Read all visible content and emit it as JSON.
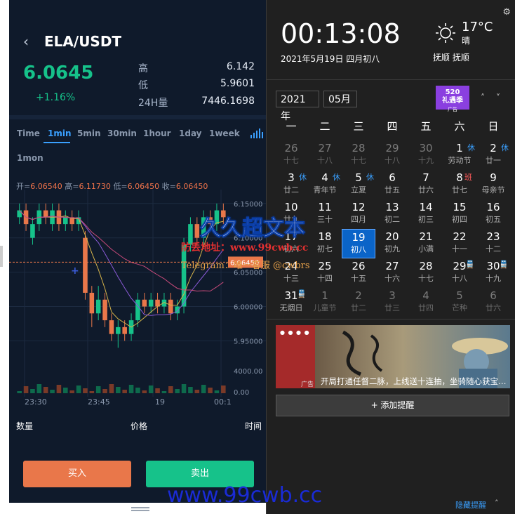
{
  "trade": {
    "back_icon": "chevron-left-icon",
    "pair": "ELA/USDT",
    "last_price": "6.0645",
    "change_pct": "+1.16%",
    "stats": [
      {
        "label": "高",
        "value": "6.142"
      },
      {
        "label": "低",
        "value": "5.9601"
      },
      {
        "label": "24H量",
        "value": "7446.1698"
      }
    ],
    "tabs": [
      "Time",
      "1min",
      "5min",
      "30min",
      "1hour",
      "1day",
      "1week",
      "1mon"
    ],
    "active_tab": "1min",
    "ohlc": {
      "open_label": "开=",
      "open": "6.06540",
      "high_label": "高=",
      "high": "6.11730",
      "low_label": "低=",
      "low": "6.06450",
      "close_label": "收=",
      "close": "6.06450"
    },
    "bottom_headers": {
      "qty": "数量",
      "price": "价格",
      "time": "时间"
    },
    "buy_label": "买入",
    "sell_label": "卖出",
    "colors": {
      "up": "#16c28a",
      "down": "#e9774a",
      "accent": "#3aa0ff"
    }
  },
  "chart_data": {
    "type": "candlestick",
    "y_ticks": [
      "6.15000",
      "6.10000",
      "6.05000",
      "6.00000",
      "5.95000"
    ],
    "volume_ticks": [
      "4000.00",
      "0.00"
    ],
    "current_price_label": "6.06450",
    "x_labels": [
      "23:30",
      "23:45",
      "19",
      "00:1"
    ],
    "candles": [
      {
        "o": 6.13,
        "c": 6.14,
        "h": 6.15,
        "l": 6.12,
        "up": true
      },
      {
        "o": 6.14,
        "c": 6.12,
        "h": 6.15,
        "l": 6.11,
        "up": false
      },
      {
        "o": 6.1,
        "c": 6.12,
        "h": 6.13,
        "l": 6.09,
        "up": true
      },
      {
        "o": 6.12,
        "c": 6.14,
        "h": 6.15,
        "l": 6.11,
        "up": true
      },
      {
        "o": 6.14,
        "c": 6.13,
        "h": 6.15,
        "l": 6.12,
        "up": false
      },
      {
        "o": 6.12,
        "c": 6.14,
        "h": 6.15,
        "l": 6.11,
        "up": true
      },
      {
        "o": 6.14,
        "c": 6.12,
        "h": 6.15,
        "l": 6.11,
        "up": false
      },
      {
        "o": 6.12,
        "c": 6.13,
        "h": 6.14,
        "l": 6.11,
        "up": true
      },
      {
        "o": 6.13,
        "c": 6.12,
        "h": 6.14,
        "l": 6.11,
        "up": false
      },
      {
        "o": 6.12,
        "c": 6.13,
        "h": 6.14,
        "l": 6.11,
        "up": true
      },
      {
        "o": 6.1,
        "c": 6.02,
        "h": 6.11,
        "l": 6.01,
        "up": false
      },
      {
        "o": 6.02,
        "c": 5.99,
        "h": 6.03,
        "l": 5.97,
        "up": false
      },
      {
        "o": 5.99,
        "c": 6.01,
        "h": 6.03,
        "l": 5.98,
        "up": true
      },
      {
        "o": 6.01,
        "c": 5.98,
        "h": 6.02,
        "l": 5.97,
        "up": false
      },
      {
        "o": 5.98,
        "c": 5.96,
        "h": 5.99,
        "l": 5.95,
        "up": false
      },
      {
        "o": 5.96,
        "c": 5.97,
        "h": 5.98,
        "l": 5.94,
        "up": true
      },
      {
        "o": 5.97,
        "c": 5.96,
        "h": 5.98,
        "l": 5.95,
        "up": false
      },
      {
        "o": 5.96,
        "c": 5.98,
        "h": 5.99,
        "l": 5.95,
        "up": true
      },
      {
        "o": 5.98,
        "c": 6.01,
        "h": 6.02,
        "l": 5.97,
        "up": true
      },
      {
        "o": 6.01,
        "c": 6.0,
        "h": 6.02,
        "l": 5.99,
        "up": false
      },
      {
        "o": 6.0,
        "c": 6.01,
        "h": 6.02,
        "l": 5.99,
        "up": true
      },
      {
        "o": 6.01,
        "c": 6.0,
        "h": 6.02,
        "l": 5.99,
        "up": false
      },
      {
        "o": 6.0,
        "c": 6.01,
        "h": 6.02,
        "l": 5.99,
        "up": true
      },
      {
        "o": 6.01,
        "c": 5.99,
        "h": 6.02,
        "l": 5.98,
        "up": false
      },
      {
        "o": 5.99,
        "c": 6.0,
        "h": 6.01,
        "l": 5.98,
        "up": true
      },
      {
        "o": 6.0,
        "c": 6.09,
        "h": 6.1,
        "l": 5.99,
        "up": true
      },
      {
        "o": 6.09,
        "c": 6.12,
        "h": 6.13,
        "l": 6.08,
        "up": true
      },
      {
        "o": 6.12,
        "c": 6.1,
        "h": 6.13,
        "l": 6.09,
        "up": false
      },
      {
        "o": 6.1,
        "c": 6.13,
        "h": 6.14,
        "l": 6.09,
        "up": true
      },
      {
        "o": 6.13,
        "c": 6.12,
        "h": 6.14,
        "l": 6.11,
        "up": false
      },
      {
        "o": 6.12,
        "c": 6.14,
        "h": 6.15,
        "l": 6.11,
        "up": true
      },
      {
        "o": 6.14,
        "c": 6.13,
        "h": 6.15,
        "l": 6.12,
        "up": false
      }
    ],
    "ylim": [
      5.93,
      6.16
    ]
  },
  "calendar_panel": {
    "settings_icon": "gear-icon",
    "time": "00:13:08",
    "date": "2021年5月19日  四月初八",
    "weather": {
      "icon": "sun-icon",
      "temp": "17°C",
      "desc": "晴",
      "location": "抚顺 抚顺"
    },
    "year_select": "2021年",
    "month_select": "05月",
    "promo": {
      "line1": "520",
      "line2": "礼遇季",
      "tag": "广告"
    },
    "nav": {
      "up": "˄",
      "down": "˅"
    },
    "weekdays": [
      "一",
      "二",
      "三",
      "四",
      "五",
      "六",
      "日"
    ],
    "days": [
      {
        "n": "26",
        "s": "十七",
        "other": true
      },
      {
        "n": "27",
        "s": "十八",
        "other": true
      },
      {
        "n": "28",
        "s": "十七",
        "other": true
      },
      {
        "n": "29",
        "s": "十八",
        "other": true
      },
      {
        "n": "30",
        "s": "十九",
        "other": true
      },
      {
        "n": "1",
        "s": "劳动节",
        "tag": "休",
        "tagtype": "rest"
      },
      {
        "n": "2",
        "s": "廿一",
        "tag": "休",
        "tagtype": "rest"
      },
      {
        "n": "3",
        "s": "廿二",
        "tag": "休",
        "tagtype": "rest"
      },
      {
        "n": "4",
        "s": "青年节",
        "tag": "休",
        "tagtype": "rest"
      },
      {
        "n": "5",
        "s": "立夏",
        "tag": "休",
        "tagtype": "rest"
      },
      {
        "n": "6",
        "s": "廿五"
      },
      {
        "n": "7",
        "s": "廿六"
      },
      {
        "n": "8",
        "s": "廿七",
        "tag": "班",
        "tagtype": "work"
      },
      {
        "n": "9",
        "s": "母亲节"
      },
      {
        "n": "10",
        "s": "廿九"
      },
      {
        "n": "11",
        "s": "三十"
      },
      {
        "n": "12",
        "s": "四月"
      },
      {
        "n": "13",
        "s": "初二"
      },
      {
        "n": "14",
        "s": "初三"
      },
      {
        "n": "15",
        "s": "初四"
      },
      {
        "n": "16",
        "s": "初五"
      },
      {
        "n": "17",
        "s": "初六"
      },
      {
        "n": "18",
        "s": "初七"
      },
      {
        "n": "19",
        "s": "初八",
        "today": true
      },
      {
        "n": "20",
        "s": "初九"
      },
      {
        "n": "21",
        "s": "小满"
      },
      {
        "n": "22",
        "s": "十一"
      },
      {
        "n": "23",
        "s": "十二"
      },
      {
        "n": "24",
        "s": "十三"
      },
      {
        "n": "25",
        "s": "十四"
      },
      {
        "n": "26",
        "s": "十五"
      },
      {
        "n": "27",
        "s": "十六"
      },
      {
        "n": "28",
        "s": "十七"
      },
      {
        "n": "29",
        "s": "十八",
        "tag": "🚆",
        "tagtype": "trn"
      },
      {
        "n": "30",
        "s": "十九",
        "tag": "🚆",
        "tagtype": "trn"
      },
      {
        "n": "31",
        "s": "无烟日",
        "tag": "🚆",
        "tagtype": "trn"
      },
      {
        "n": "1",
        "s": "儿童节",
        "other": true
      },
      {
        "n": "2",
        "s": "廿二",
        "other": true
      },
      {
        "n": "3",
        "s": "廿三",
        "other": true
      },
      {
        "n": "4",
        "s": "廿四",
        "other": true
      },
      {
        "n": "5",
        "s": "芒种",
        "other": true
      },
      {
        "n": "6",
        "s": "廿六",
        "other": true
      }
    ],
    "ad": {
      "caption": "开局打通任督二脉，上线送十连抽，坐骑随心获宝…",
      "tag": "广告"
    },
    "add_reminder": "+ 添加提醒",
    "hide_reminder": "隐藏提醒",
    "hide_arrow": "˄"
  },
  "watermarks": {
    "line1": "久久超文本",
    "line2": "防丢地址：www.99cwb.cc",
    "line3": "Telegram：唯一客服 @cwbrs",
    "line4": "www.99cwb.cc"
  }
}
